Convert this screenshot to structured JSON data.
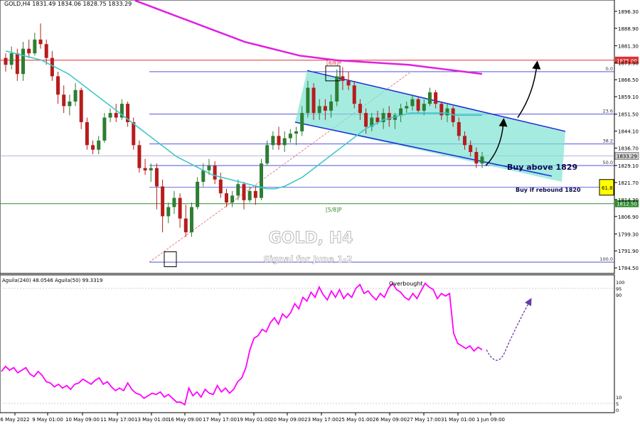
{
  "header": {
    "symbol_line": "GOLD,H4  1831.49 1834.06 1828.75 1833.29"
  },
  "overlay_text": {
    "title": "GOLD, H4",
    "subtitle": "Signal for June 1-2",
    "buy_above": "Buy above 1829",
    "buy_rebound": "Buy if rebound 1820",
    "murray_label": "[5/8]P",
    "murray_top": "[8/8]P",
    "overbought": "Overbought"
  },
  "colors": {
    "bull": "#2e7d32",
    "bear": "#b71c1c",
    "sma": "#40c8c8",
    "ema200": "#e020e0",
    "fib": "#3a3ad8",
    "channel_fill": "#7fe3d3",
    "channel_line": "#1a2ad8",
    "red_level": "#e03030",
    "green_level": "#2e8b2e",
    "oscillator": "#ff00ff",
    "yellow_tag": "#ffff00"
  },
  "chart_data": [
    {
      "type": "candlestick",
      "panel": "price",
      "title": "GOLD,H4",
      "ylim": [
        1783,
        1900
      ],
      "yticks": [
        1896.3,
        1888.9,
        1881.3,
        1873.9,
        1866.5,
        1859.1,
        1851.5,
        1844.1,
        1836.7,
        1829.1,
        1821.7,
        1814.3,
        1806.9,
        1799.3,
        1791.9,
        1784.5
      ],
      "ytick_labels": [
        "1896.30",
        "1888.90",
        "1881.30",
        "1873.90",
        "1866.50",
        "1859.10",
        "1851.50",
        "1844.10",
        "1836.70",
        "1829.10",
        "1821.70",
        "1814.30",
        "1806.90",
        "1799.30",
        "1791.90",
        "1784.50"
      ],
      "xtick_labels": [
        "6 May 2022",
        "9 May 01:00",
        "10 May 09:00",
        "11 May 17:00",
        "13 May 01:00",
        "16 May 09:00",
        "17 May 17:00",
        "19 May 01:00",
        "20 May 09:00",
        "23 May 17:00",
        "25 May 01:00",
        "26 May 09:00",
        "27 May 17:00",
        "31 May 01:00",
        "1 Jun 09:00"
      ],
      "candles": [
        [
          1876,
          1878,
          1870,
          1873
        ],
        [
          1873,
          1881,
          1871,
          1878
        ],
        [
          1878,
          1880,
          1866,
          1869
        ],
        [
          1869,
          1883,
          1866,
          1880
        ],
        [
          1880,
          1884,
          1876,
          1878
        ],
        [
          1878,
          1887,
          1877,
          1884
        ],
        [
          1884,
          1891,
          1880,
          1882
        ],
        [
          1882,
          1884,
          1873,
          1876
        ],
        [
          1876,
          1879,
          1866,
          1868
        ],
        [
          1868,
          1870,
          1856,
          1860
        ],
        [
          1860,
          1864,
          1852,
          1855
        ],
        [
          1855,
          1860,
          1851,
          1857
        ],
        [
          1857,
          1865,
          1855,
          1862
        ],
        [
          1862,
          1863,
          1845,
          1848
        ],
        [
          1848,
          1850,
          1836,
          1838
        ],
        [
          1838,
          1840,
          1834,
          1836
        ],
        [
          1836,
          1842,
          1834,
          1840
        ],
        [
          1840,
          1852,
          1839,
          1850
        ],
        [
          1850,
          1854,
          1848,
          1852
        ],
        [
          1852,
          1856,
          1848,
          1850
        ],
        [
          1850,
          1858,
          1849,
          1856
        ],
        [
          1856,
          1857,
          1846,
          1848
        ],
        [
          1848,
          1850,
          1836,
          1838
        ],
        [
          1838,
          1840,
          1826,
          1828
        ],
        [
          1828,
          1832,
          1825,
          1827
        ],
        [
          1827,
          1830,
          1822,
          1828
        ],
        [
          1828,
          1830,
          1810,
          1820
        ],
        [
          1820,
          1823,
          1800,
          1807
        ],
        [
          1807,
          1813,
          1804,
          1811
        ],
        [
          1811,
          1818,
          1808,
          1815
        ],
        [
          1815,
          1817,
          1802,
          1806
        ],
        [
          1806,
          1812,
          1798,
          1800
        ],
        [
          1800,
          1813,
          1798,
          1811
        ],
        [
          1811,
          1824,
          1810,
          1822
        ],
        [
          1822,
          1830,
          1820,
          1827
        ],
        [
          1827,
          1832,
          1825,
          1829
        ],
        [
          1829,
          1831,
          1821,
          1823
        ],
        [
          1823,
          1826,
          1815,
          1817
        ],
        [
          1817,
          1819,
          1811,
          1813
        ],
        [
          1813,
          1818,
          1811,
          1816
        ],
        [
          1816,
          1823,
          1814,
          1821
        ],
        [
          1821,
          1822,
          1810,
          1814
        ],
        [
          1814,
          1820,
          1813,
          1818
        ],
        [
          1818,
          1820,
          1812,
          1815
        ],
        [
          1815,
          1832,
          1814,
          1830
        ],
        [
          1830,
          1840,
          1829,
          1838
        ],
        [
          1838,
          1844,
          1836,
          1842
        ],
        [
          1842,
          1846,
          1836,
          1838
        ],
        [
          1838,
          1844,
          1835,
          1841
        ],
        [
          1841,
          1845,
          1839,
          1843
        ],
        [
          1843,
          1846,
          1838,
          1844
        ],
        [
          1844,
          1855,
          1842,
          1852
        ],
        [
          1852,
          1866,
          1850,
          1863
        ],
        [
          1863,
          1865,
          1849,
          1852
        ],
        [
          1852,
          1858,
          1849,
          1855
        ],
        [
          1855,
          1858,
          1849,
          1853
        ],
        [
          1853,
          1860,
          1850,
          1857
        ],
        [
          1857,
          1871,
          1855,
          1868
        ],
        [
          1868,
          1872,
          1862,
          1866
        ],
        [
          1866,
          1870,
          1862,
          1864
        ],
        [
          1864,
          1866,
          1854,
          1856
        ],
        [
          1856,
          1858,
          1849,
          1852
        ],
        [
          1852,
          1854,
          1843,
          1846
        ],
        [
          1846,
          1852,
          1844,
          1850
        ],
        [
          1850,
          1853,
          1847,
          1848
        ],
        [
          1848,
          1854,
          1845,
          1852
        ],
        [
          1852,
          1855,
          1846,
          1849
        ],
        [
          1849,
          1852,
          1845,
          1851
        ],
        [
          1851,
          1856,
          1848,
          1854
        ],
        [
          1854,
          1857,
          1852,
          1855
        ],
        [
          1855,
          1860,
          1853,
          1858
        ],
        [
          1858,
          1859,
          1852,
          1853
        ],
        [
          1853,
          1858,
          1851,
          1856
        ],
        [
          1856,
          1863,
          1855,
          1861
        ],
        [
          1861,
          1862,
          1854,
          1856
        ],
        [
          1856,
          1857,
          1849,
          1851
        ],
        [
          1851,
          1856,
          1848,
          1854
        ],
        [
          1854,
          1855,
          1846,
          1848
        ],
        [
          1848,
          1850,
          1840,
          1842
        ],
        [
          1842,
          1844,
          1836,
          1838
        ],
        [
          1838,
          1840,
          1833,
          1835
        ],
        [
          1835,
          1837,
          1828,
          1830
        ],
        [
          1830,
          1835,
          1828,
          1833
        ]
      ],
      "sma_values": [
        1879,
        1878,
        1877,
        1876,
        1875,
        1873,
        1871,
        1869,
        1866,
        1863,
        1860,
        1857,
        1854,
        1851,
        1848,
        1845,
        1842,
        1839,
        1836,
        1833,
        1831,
        1829,
        1827,
        1825,
        1824,
        1823,
        1822,
        1821,
        1820,
        1819,
        1819,
        1820,
        1822,
        1824,
        1827,
        1830,
        1833,
        1836,
        1839,
        1842,
        1845,
        1847,
        1849,
        1850,
        1851,
        1852,
        1852,
        1852,
        1852,
        1852,
        1851,
        1851,
        1851,
        1851
      ],
      "ema200_values": [
        1901,
        1898,
        1895,
        1892,
        1889,
        1886,
        1883,
        1881,
        1879,
        1877,
        1876,
        1875,
        1874.5,
        1874,
        1873.5,
        1873,
        1872,
        1871,
        1870,
        1869
      ],
      "fib_levels": [
        {
          "label": "0.0",
          "value": 1870.0
        },
        {
          "label": "23.6",
          "value": 1851.5
        },
        {
          "label": "38.2",
          "value": 1838.5
        },
        {
          "label": "50.0",
          "value": 1829.1
        },
        {
          "label": "61.8",
          "value": 1819.6
        },
        {
          "label": "100.0",
          "value": 1787.0
        }
      ],
      "horizontal_levels": [
        {
          "label": "1875.00",
          "value": 1875.0
        },
        {
          "label": "1833.29",
          "value": 1833.29
        },
        {
          "label": "1812.50",
          "value": 1812.5
        }
      ]
    },
    {
      "type": "line",
      "panel": "oscillator",
      "title": "Aguila(240) 48.0546  Aguila(50) 99.3319",
      "ylim": [
        0,
        100
      ],
      "yticks": [
        100,
        95,
        90,
        10,
        5,
        0
      ],
      "ytick_labels": [
        "100",
        "95",
        "90",
        "10",
        "5",
        "0"
      ],
      "series": [
        {
          "name": "Aguila(50)",
          "values": [
            30,
            34,
            31,
            33,
            29,
            31,
            33,
            28,
            26,
            30,
            27,
            22,
            21,
            18,
            20,
            17,
            19,
            16,
            20,
            21,
            24,
            22,
            20,
            23,
            25,
            20,
            22,
            18,
            15,
            17,
            15,
            21,
            16,
            13,
            12,
            9,
            11,
            13,
            12,
            14,
            10,
            12,
            9,
            6,
            6,
            4,
            17,
            11,
            14,
            10,
            16,
            13,
            12,
            19,
            14,
            17,
            13,
            16,
            22,
            25,
            33,
            47,
            56,
            58,
            63,
            61,
            68,
            72,
            67,
            75,
            72,
            76,
            83,
            79,
            88,
            85,
            92,
            88,
            96,
            90,
            86,
            93,
            88,
            94,
            87,
            91,
            88,
            95,
            98,
            91,
            93,
            89,
            86,
            91,
            88,
            95,
            99,
            94,
            92,
            88,
            86,
            91,
            87,
            93,
            99,
            96,
            94,
            87,
            91,
            89,
            91,
            60,
            52,
            50,
            48,
            50,
            46,
            49,
            47
          ]
        }
      ]
    }
  ]
}
